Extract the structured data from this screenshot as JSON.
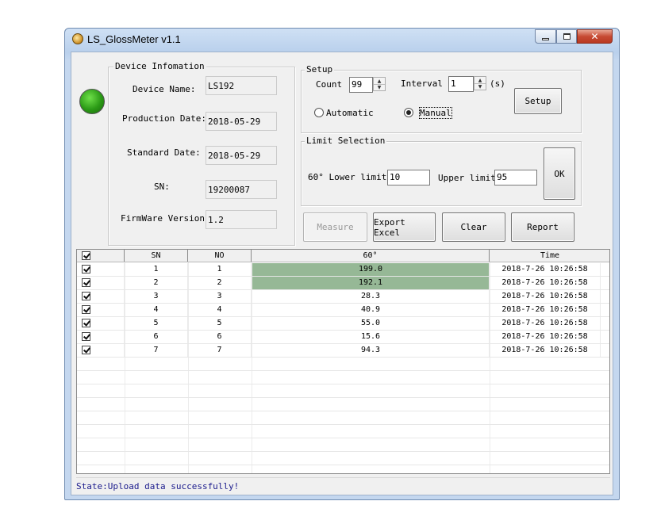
{
  "window": {
    "title": "LS_GlossMeter v1.1"
  },
  "device_info": {
    "title": "Device Infomation",
    "name_label": "Device Name:",
    "name": "LS192",
    "production_label": "Production Date:",
    "production": "2018-05-29",
    "standard_label": "Standard Date:",
    "standard": "2018-05-29",
    "sn_label": "SN:",
    "sn": "19200087",
    "firmware_label": "FirmWare Version:",
    "firmware": "1.2"
  },
  "setup": {
    "title": "Setup",
    "count_label": "Count",
    "count": "99",
    "interval_label": "Interval",
    "interval": "1",
    "unit": "(s)",
    "automatic_label": "Automatic",
    "manual_label": "Manual",
    "mode": "manual",
    "setup_button": "Setup"
  },
  "limit": {
    "title": "Limit Selection",
    "lower_label": "60° Lower limit",
    "lower": "10",
    "upper_label": "Upper limit",
    "upper": "95",
    "ok_button": "OK"
  },
  "actions": {
    "measure": "Measure",
    "export": "Export Excel",
    "clear": "Clear",
    "report": "Report"
  },
  "table": {
    "headers": {
      "sn": "SN",
      "no": "NO",
      "angle": "60°",
      "time": "Time"
    },
    "rows": [
      {
        "sn": "1",
        "no": "1",
        "value": "199.0",
        "time": "2018-7-26 10:26:58",
        "out_of_limit": true
      },
      {
        "sn": "2",
        "no": "2",
        "value": "192.1",
        "time": "2018-7-26 10:26:58",
        "out_of_limit": true
      },
      {
        "sn": "3",
        "no": "3",
        "value": "28.3",
        "time": "2018-7-26 10:26:58",
        "out_of_limit": false
      },
      {
        "sn": "4",
        "no": "4",
        "value": "40.9",
        "time": "2018-7-26 10:26:58",
        "out_of_limit": false
      },
      {
        "sn": "5",
        "no": "5",
        "value": "55.0",
        "time": "2018-7-26 10:26:58",
        "out_of_limit": false
      },
      {
        "sn": "6",
        "no": "6",
        "value": "15.6",
        "time": "2018-7-26 10:26:58",
        "out_of_limit": false
      },
      {
        "sn": "7",
        "no": "7",
        "value": "94.3",
        "time": "2018-7-26 10:26:58",
        "out_of_limit": false
      }
    ]
  },
  "status": {
    "text": "State:Upload data successfully!"
  },
  "colors": {
    "highlight": "#96b896",
    "led": "#2b9a16",
    "status_text": "#1a1a8c"
  }
}
